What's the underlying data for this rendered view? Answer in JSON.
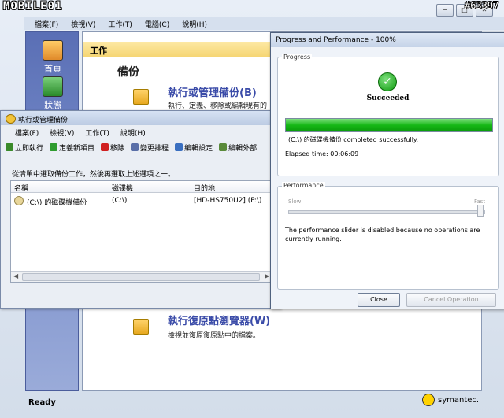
{
  "watermark": "MOBILE01",
  "image_id": "#63397",
  "main_window": {
    "buttons": {
      "minimize": "−",
      "maximize": "□",
      "close": "✕"
    },
    "menu": [
      "檔案(F)",
      "檢視(V)",
      "工作(T)",
      "電腦(C)",
      "說明(H)"
    ],
    "nav": [
      {
        "label": "首頁",
        "icon": "home-icon"
      },
      {
        "label": "狀態",
        "icon": "monitor-icon"
      }
    ],
    "work_header": "工作",
    "section_title": "備份",
    "manage": {
      "title": "執行或管理備份(B)",
      "desc": "執行、定義、移除或編輯現有的"
    },
    "restore": {
      "title": "執行復原點瀏覽器(W)",
      "desc": "檢視並復原復原點中的檔案。"
    },
    "status": "Ready",
    "brand": "symantec."
  },
  "manage_backups": {
    "title": "執行或管理備份",
    "menu": [
      "檔案(F)",
      "檢視(V)",
      "工作(T)",
      "說明(H)"
    ],
    "toolbar": [
      {
        "label": "立即執行",
        "icon": "run-icon",
        "color": "#3a8a2a"
      },
      {
        "label": "定義新項目",
        "icon": "add-icon",
        "color": "#2e9b2e"
      },
      {
        "label": "移除",
        "icon": "remove-icon",
        "color": "#d02020"
      },
      {
        "label": "變更排程",
        "icon": "schedule-icon",
        "color": "#5a6fa8"
      },
      {
        "label": "編輯設定",
        "icon": "edit-icon",
        "color": "#3a6fc0"
      },
      {
        "label": "編輯外部",
        "icon": "external-icon",
        "color": "#5a8a3a"
      }
    ],
    "instruction": "從清單中選取備份工作，然後再選取上述選項之一。",
    "columns": [
      "名稱",
      "磁碟機",
      "目的地"
    ],
    "rows": [
      {
        "name": "(C:\\) 的磁碟機備份",
        "drive": "(C:\\)",
        "dest": "[HD-HS750U2] (F:\\)"
      }
    ]
  },
  "progress": {
    "title": "Progress and Performance - 100%",
    "progress_label": "Progress",
    "status": "Succeeded",
    "percent": 100,
    "done_text": "(C:\\) 的磁碟機備份 completed successfully.",
    "elapsed": "Elapsed time:  00:06:09",
    "performance_label": "Performance",
    "slow": "Slow",
    "fast": "Fast",
    "slider_value": 1.0,
    "note": "The performance slider is disabled because no operations are currently running.",
    "close_btn": "Close",
    "cancel_btn": "Cancel Operation"
  }
}
